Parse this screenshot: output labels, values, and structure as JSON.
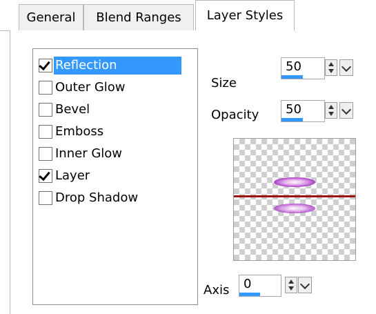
{
  "tabs": [
    {
      "label": "General",
      "active": false
    },
    {
      "label": "Blend Ranges",
      "active": false
    },
    {
      "label": "Layer Styles",
      "active": true
    }
  ],
  "effects": [
    {
      "label": "Reflection",
      "checked": true,
      "selected": true
    },
    {
      "label": "Outer Glow",
      "checked": false,
      "selected": false
    },
    {
      "label": "Bevel",
      "checked": false,
      "selected": false
    },
    {
      "label": "Emboss",
      "checked": false,
      "selected": false
    },
    {
      "label": "Inner Glow",
      "checked": false,
      "selected": false
    },
    {
      "label": "Layer",
      "checked": true,
      "selected": false
    },
    {
      "label": "Drop Shadow",
      "checked": false,
      "selected": false
    }
  ],
  "size": {
    "label": "Size",
    "value": "50",
    "level_fraction": 0.5
  },
  "opacity": {
    "label": "Opacity",
    "value": "50",
    "level_fraction": 0.5
  },
  "axis": {
    "label": "Axis",
    "value": "0",
    "level_fraction": 0.5
  },
  "colors": {
    "selection": "#3399ff",
    "reflection_line": "#a01010",
    "preview_glow": "#a030c0"
  }
}
